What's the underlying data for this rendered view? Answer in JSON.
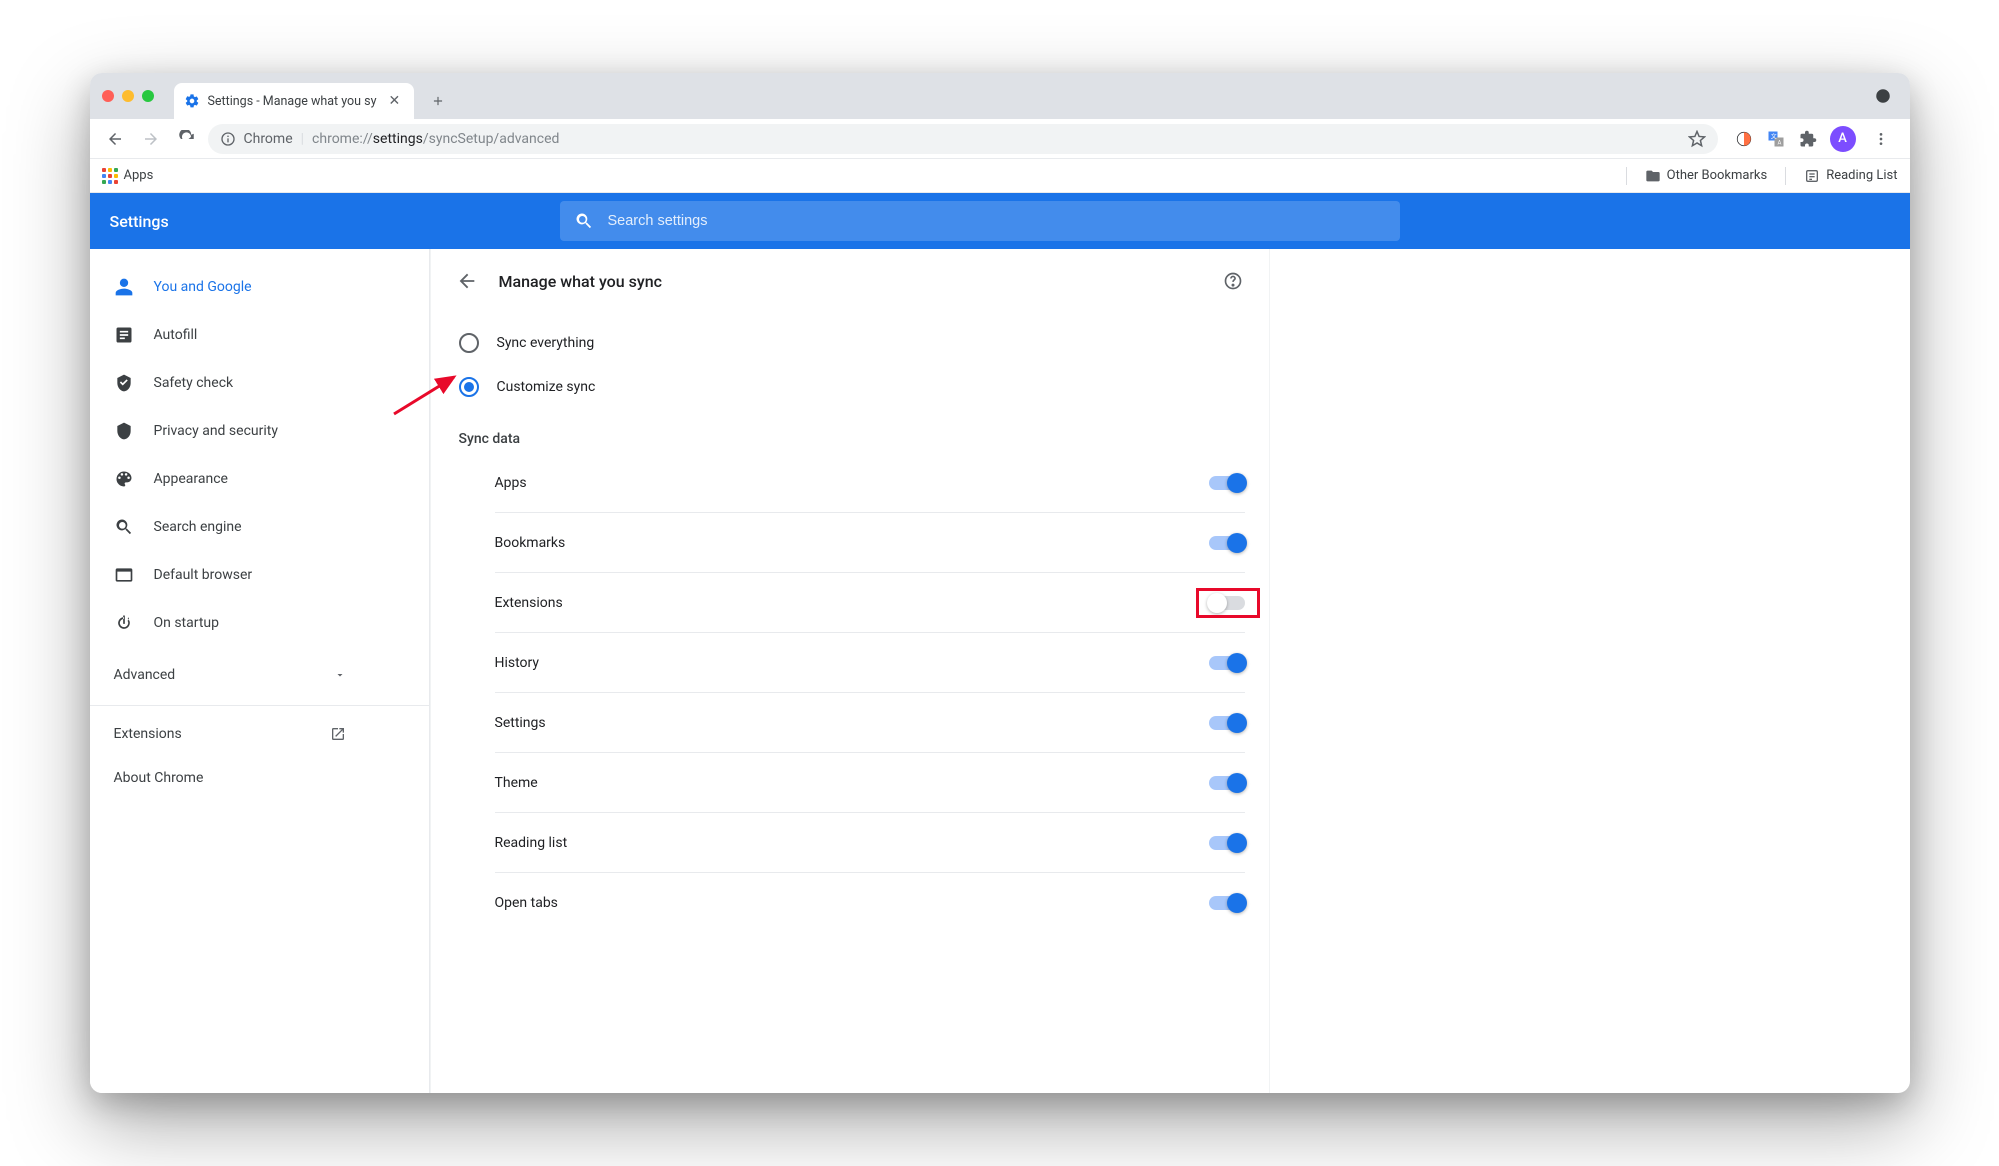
{
  "browser": {
    "tab_title": "Settings - Manage what you sy",
    "url_label": "Chrome",
    "url_prefix": "chrome://",
    "url_bold": "settings",
    "url_rest": "/syncSetup/advanced",
    "apps_label": "Apps",
    "other_bookmarks": "Other Bookmarks",
    "reading_list": "Reading List",
    "avatar_letter": "A"
  },
  "header": {
    "title": "Settings",
    "search_placeholder": "Search settings"
  },
  "sidebar": {
    "items": [
      {
        "label": "You and Google",
        "icon": "person",
        "active": true
      },
      {
        "label": "Autofill",
        "icon": "autofill",
        "active": false
      },
      {
        "label": "Safety check",
        "icon": "shield-check",
        "active": false
      },
      {
        "label": "Privacy and security",
        "icon": "shield",
        "active": false
      },
      {
        "label": "Appearance",
        "icon": "palette",
        "active": false
      },
      {
        "label": "Search engine",
        "icon": "search",
        "active": false
      },
      {
        "label": "Default browser",
        "icon": "browser",
        "active": false
      },
      {
        "label": "On startup",
        "icon": "power",
        "active": false
      }
    ],
    "advanced_label": "Advanced",
    "extensions_label": "Extensions",
    "about_label": "About Chrome"
  },
  "main": {
    "page_title": "Manage what you sync",
    "radio_sync_everything": "Sync everything",
    "radio_customize_sync": "Customize sync",
    "radio_selected": "customize",
    "sync_data_label": "Sync data",
    "toggles": [
      {
        "label": "Apps",
        "on": true
      },
      {
        "label": "Bookmarks",
        "on": true
      },
      {
        "label": "Extensions",
        "on": false,
        "highlighted": true
      },
      {
        "label": "History",
        "on": true
      },
      {
        "label": "Settings",
        "on": true
      },
      {
        "label": "Theme",
        "on": true
      },
      {
        "label": "Reading list",
        "on": true
      },
      {
        "label": "Open tabs",
        "on": true
      }
    ]
  }
}
